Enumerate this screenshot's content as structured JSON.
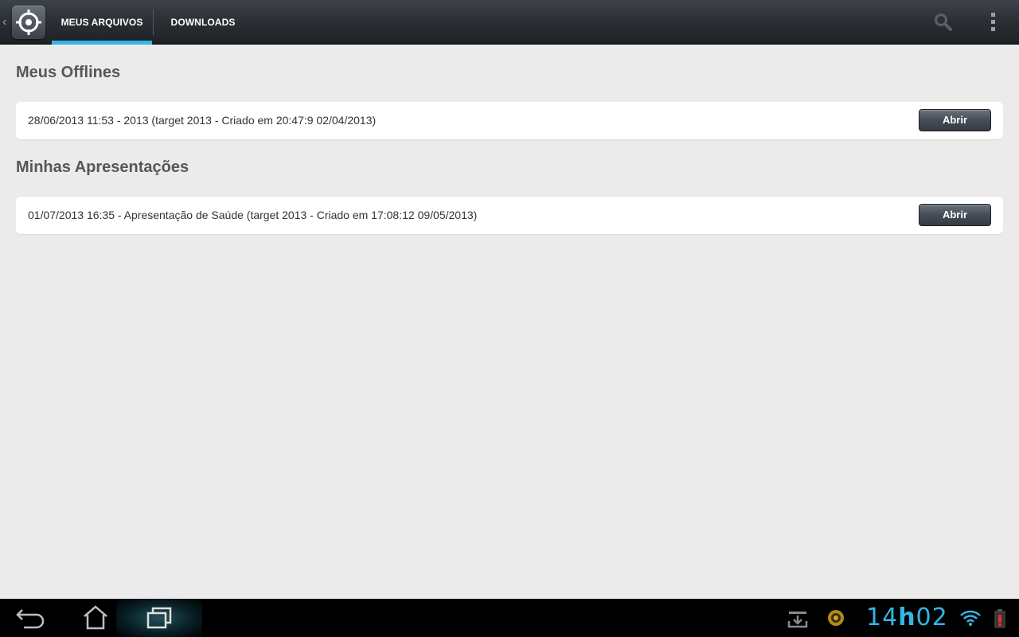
{
  "actionbar": {
    "tabs": [
      {
        "label": "MEUS ARQUIVOS",
        "selected": true
      },
      {
        "label": "DOWNLOADS",
        "selected": false
      }
    ],
    "accent_color": "#33b5e5"
  },
  "sections": [
    {
      "title": "Meus Offlines",
      "items": [
        {
          "text": "28/06/2013 11:53 - 2013 (target 2013 - Criado em 20:47:9 02/04/2013)",
          "button_label": "Abrir"
        }
      ]
    },
    {
      "title": "Minhas Apresentações",
      "items": [
        {
          "text": "01/07/2013 16:35 - Apresentação de Saúde (target 2013 - Criado em 17:08:12 09/05/2013)",
          "button_label": "Abrir"
        }
      ]
    }
  ],
  "statusbar": {
    "clock_hours": "14",
    "clock_sep": "h",
    "clock_minutes": "02"
  }
}
